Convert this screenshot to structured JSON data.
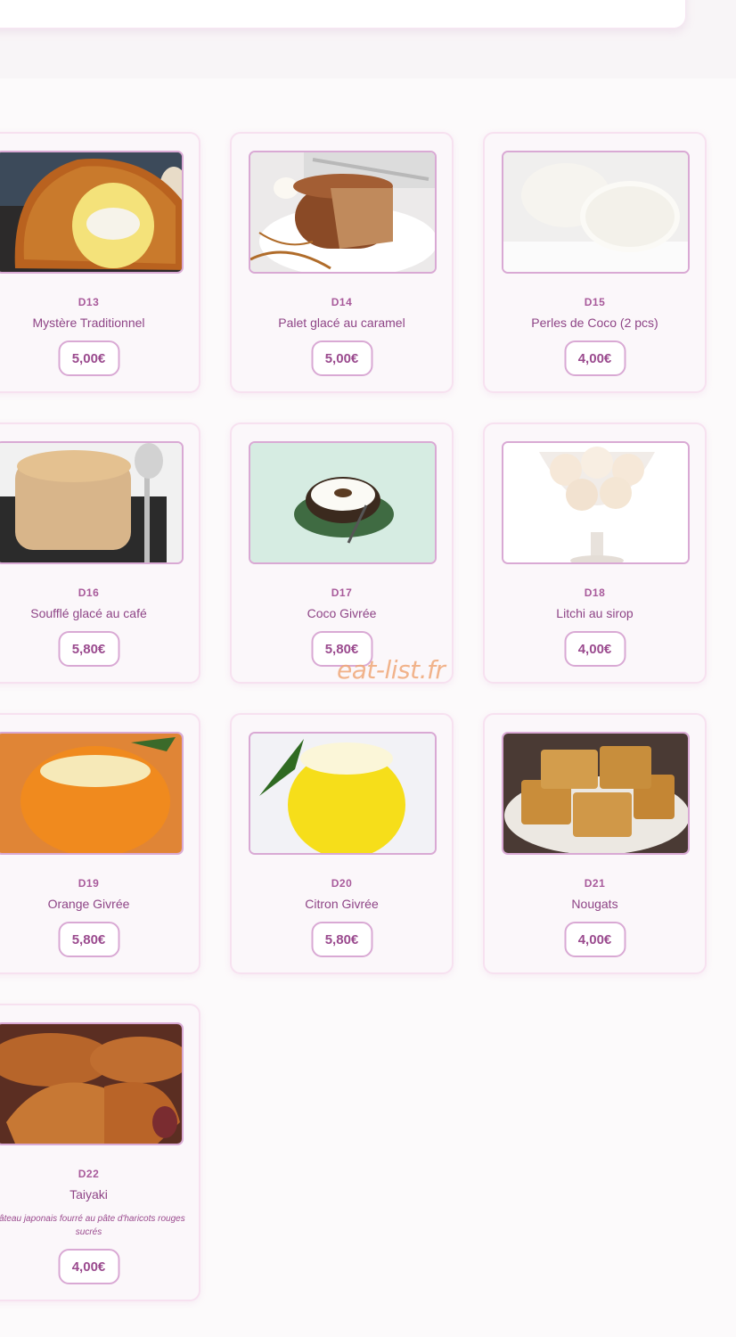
{
  "watermark": "eat-list.fr",
  "items": [
    {
      "code": "D13",
      "name": "Mystère Traditionnel",
      "price": "5,00€",
      "image": "ice-cream-bomb-image"
    },
    {
      "code": "D14",
      "name": "Palet glacé au caramel",
      "price": "5,00€",
      "image": "caramel-cake-image"
    },
    {
      "code": "D15",
      "name": "Perles de Coco (2 pcs)",
      "price": "4,00€",
      "image": "coconut-pearls-image"
    },
    {
      "code": "D16",
      "name": "Soufflé glacé au café",
      "price": "5,80€",
      "image": "coffee-souffle-image"
    },
    {
      "code": "D17",
      "name": "Coco Givrée",
      "price": "5,80€",
      "image": "frozen-coconut-image"
    },
    {
      "code": "D18",
      "name": "Litchi au sirop",
      "price": "4,00€",
      "image": "lychee-syrup-image"
    },
    {
      "code": "D19",
      "name": "Orange Givrée",
      "price": "5,80€",
      "image": "frozen-orange-image"
    },
    {
      "code": "D20",
      "name": "Citron Givrée",
      "price": "5,80€",
      "image": "frozen-lemon-image"
    },
    {
      "code": "D21",
      "name": "Nougats",
      "price": "4,00€",
      "image": "nougats-image"
    },
    {
      "code": "D22",
      "name": "Taiyaki",
      "description": "Gâteau japonais fourré au pâte d'haricots rouges sucrés",
      "price": "4,00€",
      "image": "taiyaki-image"
    }
  ]
}
